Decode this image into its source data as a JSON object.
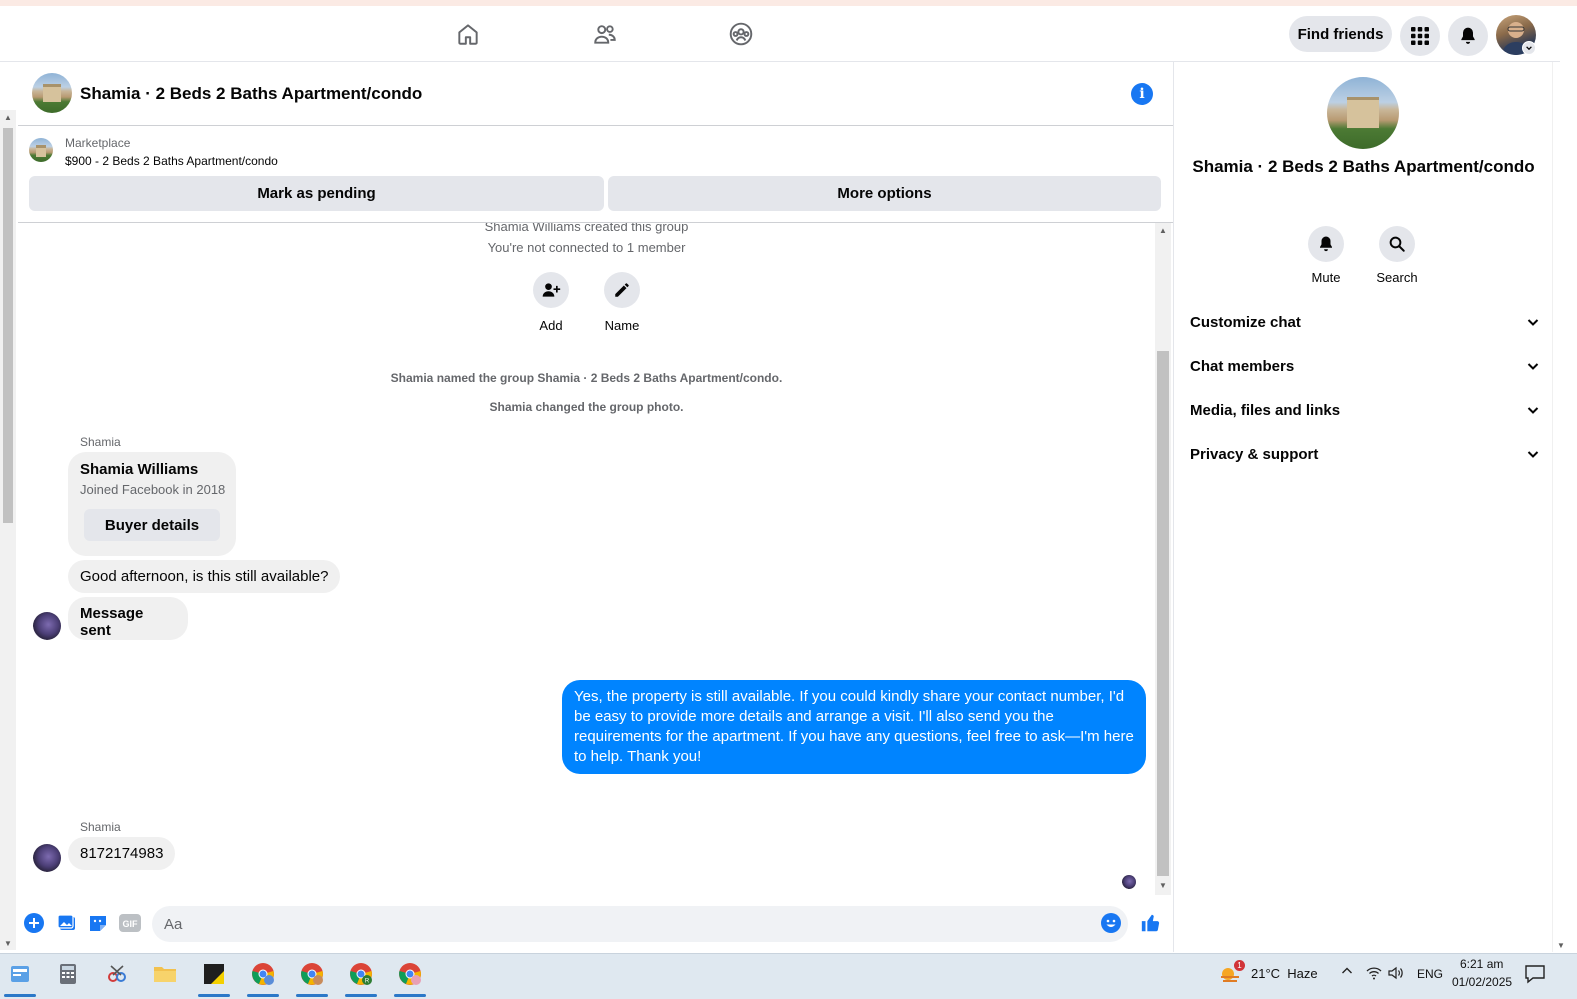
{
  "topbar": {
    "find_friends": "Find friends"
  },
  "chat": {
    "title": "Shamia · 2 Beds 2 Baths Apartment/condo"
  },
  "marketplace": {
    "label": "Marketplace",
    "item": "$900 - 2 Beds 2 Baths Apartment/condo",
    "mark_pending": "Mark as pending",
    "more_options": "More options"
  },
  "messages": {
    "created": "Shamia Williams created this group",
    "not_connected": "You're not connected to 1 member",
    "add_label": "Add",
    "name_label": "Name",
    "named_event": "Shamia named the group Shamia · 2 Beds 2 Baths Apartment/condo.",
    "photo_event": "Shamia changed the group photo.",
    "sender1": "Shamia",
    "card_name": "Shamia Williams",
    "card_joined": "Joined Facebook in 2018",
    "card_button": "Buyer details",
    "msg1": "Good afternoon, is this still available?",
    "msg2": "Message sent",
    "reply": "Yes, the property is still available. If you could kindly share your contact number, I'd be easy to provide more details and arrange a visit. I'll also send you the requirements for the apartment. If you have any questions, feel free to ask—I'm here to help. Thank you!",
    "sender2": "Shamia",
    "msg3": "8172174983"
  },
  "composer": {
    "placeholder": "Aa"
  },
  "right_panel": {
    "title": "Shamia · 2 Beds 2 Baths Apartment/condo",
    "mute": "Mute",
    "search": "Search",
    "sections": [
      "Customize chat",
      "Chat members",
      "Media, files and links",
      "Privacy & support"
    ]
  },
  "taskbar": {
    "weather_badge": "1",
    "weather": "21°C  Haze",
    "lang": "ENG",
    "time": "6:21 am",
    "date": "01/02/2025"
  },
  "colors": {
    "accent": "#1877f2",
    "outgoing_bubble": "#0084ff",
    "incoming_bubble": "#f0f0f0"
  }
}
